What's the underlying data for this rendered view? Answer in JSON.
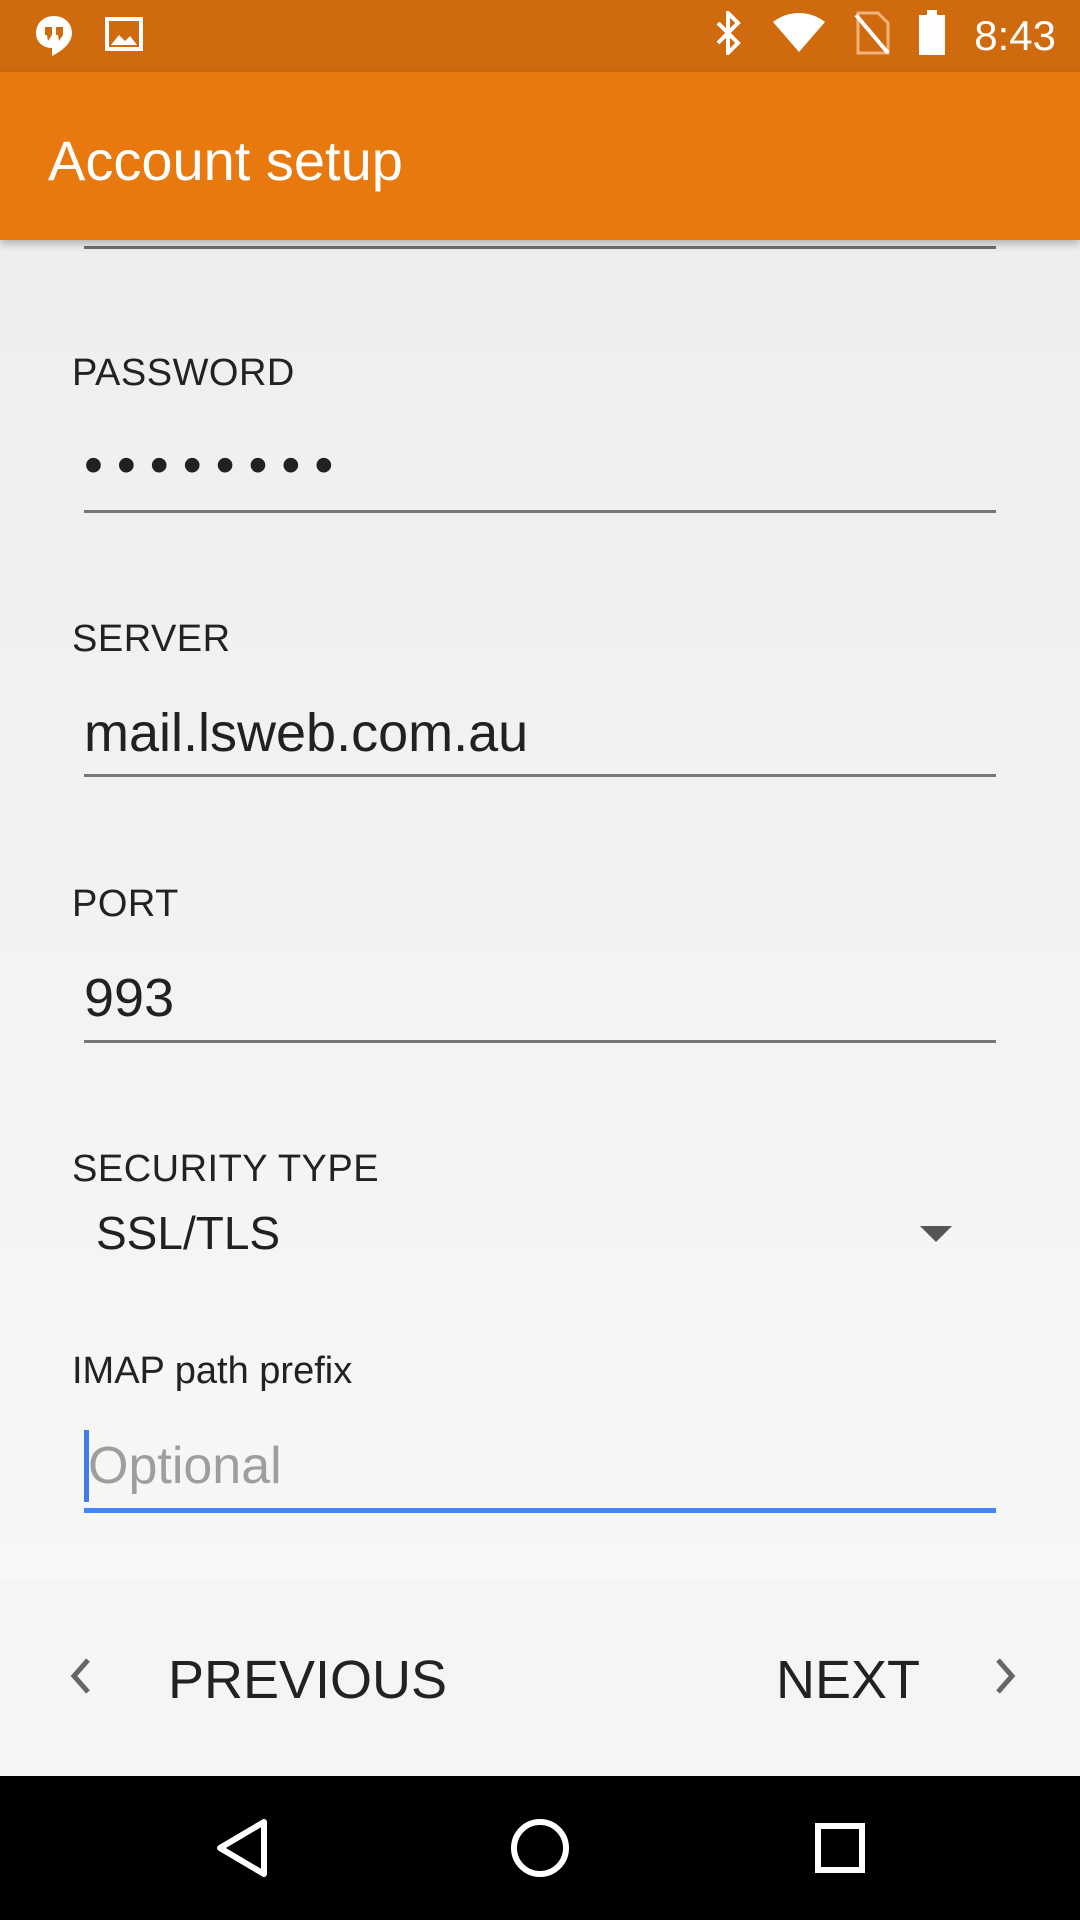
{
  "status_bar": {
    "time": "8:43",
    "left_icons": [
      "hangouts-icon",
      "image-icon"
    ],
    "right_icons": [
      "bluetooth-icon",
      "wifi-icon",
      "no-sim-icon",
      "battery-icon"
    ]
  },
  "app_bar": {
    "title": "Account setup",
    "background": "#e8790f"
  },
  "form": {
    "password": {
      "label": "PASSWORD",
      "value": "••••••••"
    },
    "server": {
      "label": "SERVER",
      "value": "mail.lsweb.com.au"
    },
    "port": {
      "label": "PORT",
      "value": "993"
    },
    "security_type": {
      "label": "SECURITY TYPE",
      "value": "SSL/TLS"
    },
    "imap_prefix": {
      "label": "IMAP path prefix",
      "placeholder": "Optional",
      "value": ""
    }
  },
  "footer": {
    "previous_label": "PREVIOUS",
    "next_label": "NEXT"
  },
  "nav_bar": {
    "icons": [
      "back-icon",
      "home-icon",
      "recents-icon"
    ]
  },
  "colors": {
    "status_bar": "#cf6a0e",
    "accent_focus": "#4285f4"
  }
}
